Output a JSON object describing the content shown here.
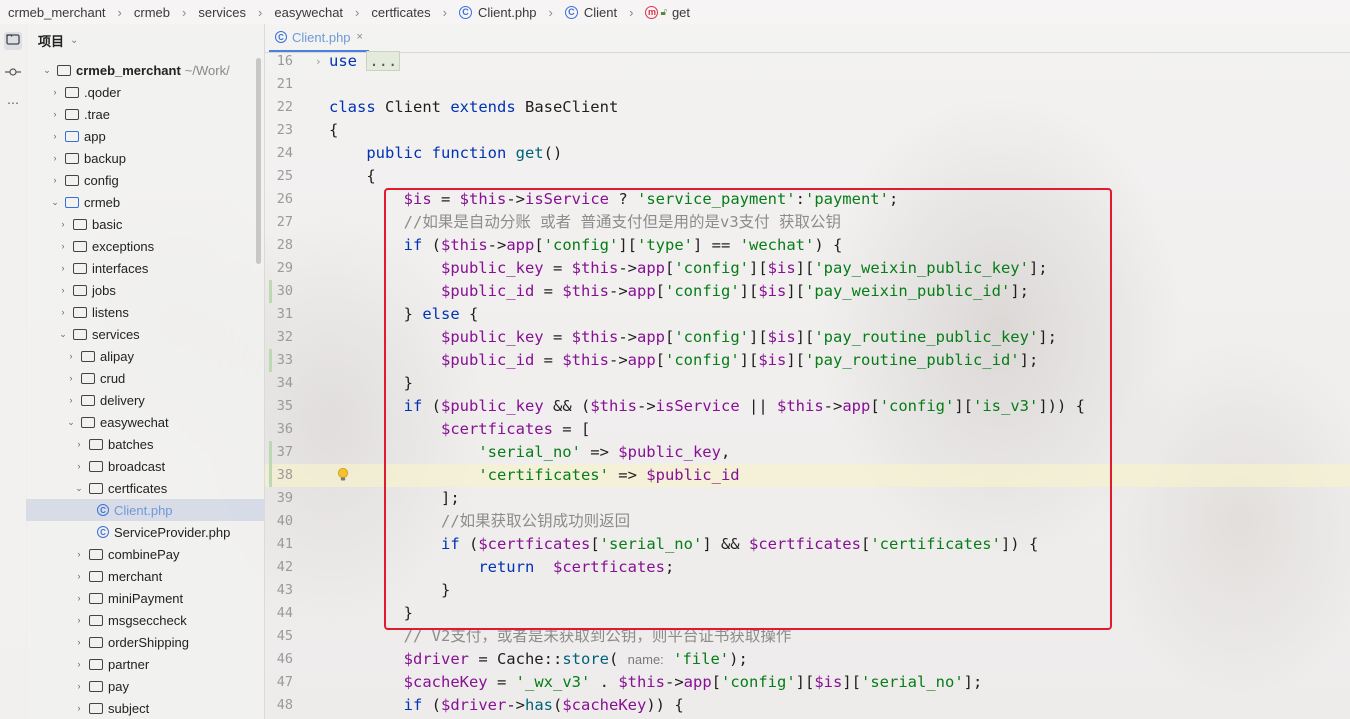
{
  "breadcrumb": [
    "crmeb_merchant",
    "crmeb",
    "services",
    "easywechat",
    "certficates",
    "Client.php",
    "Client",
    "get"
  ],
  "project_panel": {
    "title": "项目",
    "root": {
      "name": "crmeb_merchant",
      "path": "~/Work/"
    },
    "items": [
      {
        "label": ".qoder",
        "depth": 1,
        "expanded": false,
        "kind": "folder"
      },
      {
        "label": ".trae",
        "depth": 1,
        "expanded": false,
        "kind": "folder"
      },
      {
        "label": "app",
        "depth": 1,
        "expanded": false,
        "kind": "folder-blue"
      },
      {
        "label": "backup",
        "depth": 1,
        "expanded": false,
        "kind": "folder"
      },
      {
        "label": "config",
        "depth": 1,
        "expanded": false,
        "kind": "folder"
      },
      {
        "label": "crmeb",
        "depth": 1,
        "expanded": true,
        "kind": "folder-blue"
      },
      {
        "label": "basic",
        "depth": 2,
        "expanded": false,
        "kind": "folder"
      },
      {
        "label": "exceptions",
        "depth": 2,
        "expanded": false,
        "kind": "folder"
      },
      {
        "label": "interfaces",
        "depth": 2,
        "expanded": false,
        "kind": "folder"
      },
      {
        "label": "jobs",
        "depth": 2,
        "expanded": false,
        "kind": "folder"
      },
      {
        "label": "listens",
        "depth": 2,
        "expanded": false,
        "kind": "folder"
      },
      {
        "label": "services",
        "depth": 2,
        "expanded": true,
        "kind": "folder"
      },
      {
        "label": "alipay",
        "depth": 3,
        "expanded": false,
        "kind": "folder"
      },
      {
        "label": "crud",
        "depth": 3,
        "expanded": false,
        "kind": "folder"
      },
      {
        "label": "delivery",
        "depth": 3,
        "expanded": false,
        "kind": "folder"
      },
      {
        "label": "easywechat",
        "depth": 3,
        "expanded": true,
        "kind": "folder"
      },
      {
        "label": "batches",
        "depth": 4,
        "expanded": false,
        "kind": "folder"
      },
      {
        "label": "broadcast",
        "depth": 4,
        "expanded": false,
        "kind": "folder"
      },
      {
        "label": "certficates",
        "depth": 4,
        "expanded": true,
        "kind": "folder"
      },
      {
        "label": "Client.php",
        "depth": 5,
        "kind": "php",
        "selected": true
      },
      {
        "label": "ServiceProvider.php",
        "depth": 5,
        "kind": "php"
      },
      {
        "label": "combinePay",
        "depth": 4,
        "expanded": false,
        "kind": "folder"
      },
      {
        "label": "merchant",
        "depth": 4,
        "expanded": false,
        "kind": "folder"
      },
      {
        "label": "miniPayment",
        "depth": 4,
        "expanded": false,
        "kind": "folder"
      },
      {
        "label": "msgseccheck",
        "depth": 4,
        "expanded": false,
        "kind": "folder"
      },
      {
        "label": "orderShipping",
        "depth": 4,
        "expanded": false,
        "kind": "folder"
      },
      {
        "label": "partner",
        "depth": 4,
        "expanded": false,
        "kind": "folder"
      },
      {
        "label": "pay",
        "depth": 4,
        "expanded": false,
        "kind": "folder"
      },
      {
        "label": "subject",
        "depth": 4,
        "expanded": false,
        "kind": "folder"
      }
    ]
  },
  "editor": {
    "tab": {
      "label": "Client.php",
      "close": "×"
    },
    "lines": [
      {
        "n": "16",
        "tokens": [
          [
            "kw",
            "use "
          ],
          [
            "fold",
            "..."
          ]
        ]
      },
      {
        "n": "21",
        "tokens": []
      },
      {
        "n": "22",
        "tokens": [
          [
            "kw",
            "class "
          ],
          [
            "plain",
            "Client "
          ],
          [
            "kw",
            "extends "
          ],
          [
            "plain",
            "BaseClient"
          ]
        ]
      },
      {
        "n": "23",
        "tokens": [
          [
            "plain",
            "{"
          ]
        ]
      },
      {
        "n": "24",
        "tokens": [
          [
            "plain",
            "    "
          ],
          [
            "kw",
            "public function "
          ],
          [
            "fn",
            "get"
          ],
          [
            "plain",
            "()"
          ]
        ]
      },
      {
        "n": "25",
        "tokens": [
          [
            "plain",
            "    {"
          ]
        ]
      },
      {
        "n": "26",
        "tokens": [
          [
            "plain",
            "        "
          ],
          [
            "var",
            "$is"
          ],
          [
            "plain",
            " = "
          ],
          [
            "var",
            "$this"
          ],
          [
            "plain",
            "->"
          ],
          [
            "var",
            "isService"
          ],
          [
            "plain",
            " ? "
          ],
          [
            "str",
            "'service_payment'"
          ],
          [
            "plain",
            ":"
          ],
          [
            "str",
            "'payment'"
          ],
          [
            "plain",
            ";"
          ]
        ]
      },
      {
        "n": "27",
        "tokens": [
          [
            "plain",
            "        "
          ],
          [
            "cmt",
            "//如果是自动分账 或者 普通支付但是用的是v3支付 获取公钥"
          ]
        ]
      },
      {
        "n": "28",
        "tokens": [
          [
            "plain",
            "        "
          ],
          [
            "kw",
            "if"
          ],
          [
            "plain",
            " ("
          ],
          [
            "var",
            "$this"
          ],
          [
            "plain",
            "->"
          ],
          [
            "var",
            "app"
          ],
          [
            "plain",
            "["
          ],
          [
            "str",
            "'config'"
          ],
          [
            "plain",
            "]["
          ],
          [
            "str",
            "'type'"
          ],
          [
            "plain",
            "] == "
          ],
          [
            "str",
            "'wechat'"
          ],
          [
            "plain",
            ") {"
          ]
        ]
      },
      {
        "n": "29",
        "tokens": [
          [
            "plain",
            "            "
          ],
          [
            "var",
            "$public_key"
          ],
          [
            "plain",
            " = "
          ],
          [
            "var",
            "$this"
          ],
          [
            "plain",
            "->"
          ],
          [
            "var",
            "app"
          ],
          [
            "plain",
            "["
          ],
          [
            "str",
            "'config'"
          ],
          [
            "plain",
            "]["
          ],
          [
            "var",
            "$is"
          ],
          [
            "plain",
            "]["
          ],
          [
            "str",
            "'pay_weixin_public_key'"
          ],
          [
            "plain",
            "];"
          ]
        ]
      },
      {
        "n": "30",
        "tokens": [
          [
            "plain",
            "            "
          ],
          [
            "var",
            "$public_id"
          ],
          [
            "plain",
            " = "
          ],
          [
            "var",
            "$this"
          ],
          [
            "plain",
            "->"
          ],
          [
            "var",
            "app"
          ],
          [
            "plain",
            "["
          ],
          [
            "str",
            "'config'"
          ],
          [
            "plain",
            "]["
          ],
          [
            "var",
            "$is"
          ],
          [
            "plain",
            "]["
          ],
          [
            "str",
            "'pay_weixin_public_id'"
          ],
          [
            "plain",
            "];"
          ]
        ],
        "mark": true
      },
      {
        "n": "31",
        "tokens": [
          [
            "plain",
            "        } "
          ],
          [
            "kw",
            "else"
          ],
          [
            "plain",
            " {"
          ]
        ]
      },
      {
        "n": "32",
        "tokens": [
          [
            "plain",
            "            "
          ],
          [
            "var",
            "$public_key"
          ],
          [
            "plain",
            " = "
          ],
          [
            "var",
            "$this"
          ],
          [
            "plain",
            "->"
          ],
          [
            "var",
            "app"
          ],
          [
            "plain",
            "["
          ],
          [
            "str",
            "'config'"
          ],
          [
            "plain",
            "]["
          ],
          [
            "var",
            "$is"
          ],
          [
            "plain",
            "]["
          ],
          [
            "str",
            "'pay_routine_public_key'"
          ],
          [
            "plain",
            "];"
          ]
        ]
      },
      {
        "n": "33",
        "tokens": [
          [
            "plain",
            "            "
          ],
          [
            "var",
            "$public_id"
          ],
          [
            "plain",
            " = "
          ],
          [
            "var",
            "$this"
          ],
          [
            "plain",
            "->"
          ],
          [
            "var",
            "app"
          ],
          [
            "plain",
            "["
          ],
          [
            "str",
            "'config'"
          ],
          [
            "plain",
            "]["
          ],
          [
            "var",
            "$is"
          ],
          [
            "plain",
            "]["
          ],
          [
            "str",
            "'pay_routine_public_id'"
          ],
          [
            "plain",
            "];"
          ]
        ],
        "mark": true
      },
      {
        "n": "34",
        "tokens": [
          [
            "plain",
            "        }"
          ]
        ]
      },
      {
        "n": "35",
        "tokens": [
          [
            "plain",
            "        "
          ],
          [
            "kw",
            "if"
          ],
          [
            "plain",
            " ("
          ],
          [
            "var",
            "$public_key"
          ],
          [
            "plain",
            " && ("
          ],
          [
            "var",
            "$this"
          ],
          [
            "plain",
            "->"
          ],
          [
            "var",
            "isService"
          ],
          [
            "plain",
            " || "
          ],
          [
            "var",
            "$this"
          ],
          [
            "plain",
            "->"
          ],
          [
            "var",
            "app"
          ],
          [
            "plain",
            "["
          ],
          [
            "str",
            "'config'"
          ],
          [
            "plain",
            "]["
          ],
          [
            "str",
            "'is_v3'"
          ],
          [
            "plain",
            "])) {"
          ]
        ]
      },
      {
        "n": "36",
        "tokens": [
          [
            "plain",
            "            "
          ],
          [
            "var",
            "$certficates"
          ],
          [
            "plain",
            " = ["
          ]
        ]
      },
      {
        "n": "37",
        "tokens": [
          [
            "plain",
            "                "
          ],
          [
            "str",
            "'serial_no'"
          ],
          [
            "plain",
            " => "
          ],
          [
            "var",
            "$public_key"
          ],
          [
            "plain",
            ","
          ]
        ],
        "mark": true
      },
      {
        "n": "38",
        "tokens": [
          [
            "plain",
            "                "
          ],
          [
            "str",
            "'certificates'"
          ],
          [
            "plain",
            " => "
          ],
          [
            "var",
            "$public_id"
          ]
        ],
        "mark": true,
        "highlight": true,
        "bulb": true
      },
      {
        "n": "39",
        "tokens": [
          [
            "plain",
            "            ];"
          ]
        ]
      },
      {
        "n": "40",
        "tokens": [
          [
            "plain",
            "            "
          ],
          [
            "cmt",
            "//如果获取公钥成功则返回"
          ]
        ]
      },
      {
        "n": "41",
        "tokens": [
          [
            "plain",
            "            "
          ],
          [
            "kw",
            "if"
          ],
          [
            "plain",
            " ("
          ],
          [
            "var",
            "$certficates"
          ],
          [
            "plain",
            "["
          ],
          [
            "str",
            "'serial_no'"
          ],
          [
            "plain",
            "] && "
          ],
          [
            "var",
            "$certficates"
          ],
          [
            "plain",
            "["
          ],
          [
            "str",
            "'certificates'"
          ],
          [
            "plain",
            "]) {"
          ]
        ]
      },
      {
        "n": "42",
        "tokens": [
          [
            "plain",
            "                "
          ],
          [
            "kw",
            "return"
          ],
          [
            "plain",
            "  "
          ],
          [
            "var",
            "$certficates"
          ],
          [
            "plain",
            ";"
          ]
        ]
      },
      {
        "n": "43",
        "tokens": [
          [
            "plain",
            "            }"
          ]
        ]
      },
      {
        "n": "44",
        "tokens": [
          [
            "plain",
            "        }"
          ]
        ]
      },
      {
        "n": "45",
        "tokens": [
          [
            "plain",
            "        "
          ],
          [
            "cmt",
            "// V2支付，或者是未获取到公钥，则平台证书获取操作"
          ]
        ]
      },
      {
        "n": "46",
        "tokens": [
          [
            "plain",
            "        "
          ],
          [
            "var",
            "$driver"
          ],
          [
            "plain",
            " = Cache::"
          ],
          [
            "fn",
            "store"
          ],
          [
            "plain",
            "( "
          ],
          [
            "hint",
            "name:"
          ],
          [
            "plain",
            " "
          ],
          [
            "str",
            "'file'"
          ],
          [
            "plain",
            ");"
          ]
        ]
      },
      {
        "n": "47",
        "tokens": [
          [
            "plain",
            "        "
          ],
          [
            "var",
            "$cacheKey"
          ],
          [
            "plain",
            " = "
          ],
          [
            "str",
            "'_wx_v3'"
          ],
          [
            "plain",
            " . "
          ],
          [
            "var",
            "$this"
          ],
          [
            "plain",
            "->"
          ],
          [
            "var",
            "app"
          ],
          [
            "plain",
            "["
          ],
          [
            "str",
            "'config'"
          ],
          [
            "plain",
            "]["
          ],
          [
            "var",
            "$is"
          ],
          [
            "plain",
            "]["
          ],
          [
            "str",
            "'serial_no'"
          ],
          [
            "plain",
            "];"
          ]
        ]
      },
      {
        "n": "48",
        "tokens": [
          [
            "plain",
            "        "
          ],
          [
            "kw",
            "if"
          ],
          [
            "plain",
            " ("
          ],
          [
            "var",
            "$driver"
          ],
          [
            "plain",
            "->"
          ],
          [
            "fn",
            "has"
          ],
          [
            "plain",
            "("
          ],
          [
            "var",
            "$cacheKey"
          ],
          [
            "plain",
            ")) {"
          ]
        ]
      }
    ]
  },
  "colors": {
    "keyword": "#0033b3",
    "string": "#067d17",
    "variable": "#871094",
    "function": "#00627a",
    "comment": "#8c8c8c",
    "annotation_box": "#e01a2f",
    "tab_accent": "#4a80e0"
  }
}
